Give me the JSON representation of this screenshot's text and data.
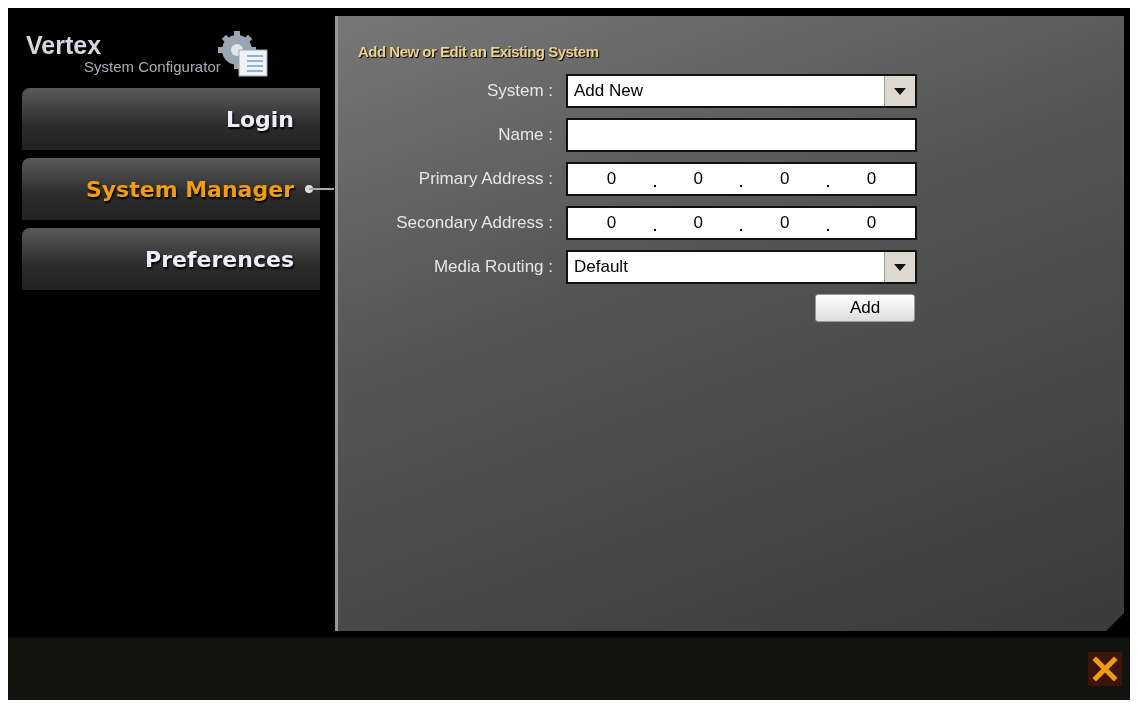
{
  "brand": {
    "title": "Vertex",
    "subtitle": "System Configurator"
  },
  "nav": [
    {
      "label": "Login",
      "selected": false
    },
    {
      "label": "System Manager",
      "selected": true
    },
    {
      "label": "Preferences",
      "selected": false
    }
  ],
  "panel": {
    "title": "Add New or Edit an Existing System",
    "fields": [
      {
        "label": "System :",
        "kind": "select",
        "value": "Add New"
      },
      {
        "label": "Name :",
        "kind": "text"
      },
      {
        "label": "Primary Address :",
        "kind": "ip",
        "octets": [
          "0",
          "0",
          "0",
          "0"
        ]
      },
      {
        "label": "Secondary Address :",
        "kind": "ip",
        "octets": [
          "0",
          "0",
          "0",
          "0"
        ]
      },
      {
        "label": "Media Routing :",
        "kind": "select",
        "value": "Default"
      }
    ],
    "button": "Add"
  }
}
